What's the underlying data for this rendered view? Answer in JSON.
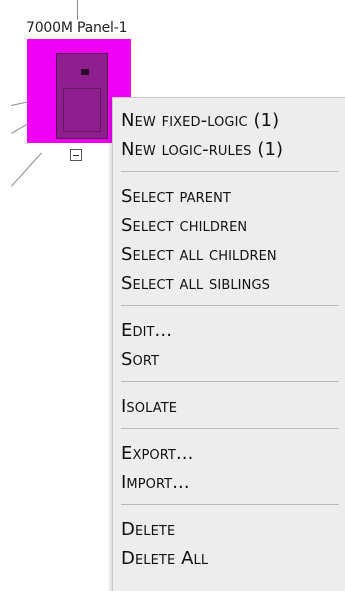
{
  "node": {
    "title": "7000M Panel-1",
    "box_color": "#f000f5"
  },
  "menu": {
    "groups": [
      {
        "items": [
          {
            "label": "New fixed-logic (1)",
            "name": "menu-new-fixed-logic"
          },
          {
            "label": "New logic-rules (1)",
            "name": "menu-new-logic-rules"
          }
        ]
      },
      {
        "items": [
          {
            "label": "Select parent",
            "name": "menu-select-parent"
          },
          {
            "label": "Select children",
            "name": "menu-select-children"
          },
          {
            "label": "Select all children",
            "name": "menu-select-all-children"
          },
          {
            "label": "Select all siblings",
            "name": "menu-select-all-siblings"
          }
        ]
      },
      {
        "items": [
          {
            "label": "Edit...",
            "name": "menu-edit"
          },
          {
            "label": "Sort",
            "name": "menu-sort"
          }
        ]
      },
      {
        "items": [
          {
            "label": "Isolate",
            "name": "menu-isolate"
          }
        ]
      },
      {
        "items": [
          {
            "label": "Export...",
            "name": "menu-export"
          },
          {
            "label": "Import...",
            "name": "menu-import"
          }
        ]
      },
      {
        "items": [
          {
            "label": "Delete",
            "name": "menu-delete"
          },
          {
            "label": "Delete All",
            "name": "menu-delete-all"
          }
        ]
      }
    ]
  }
}
